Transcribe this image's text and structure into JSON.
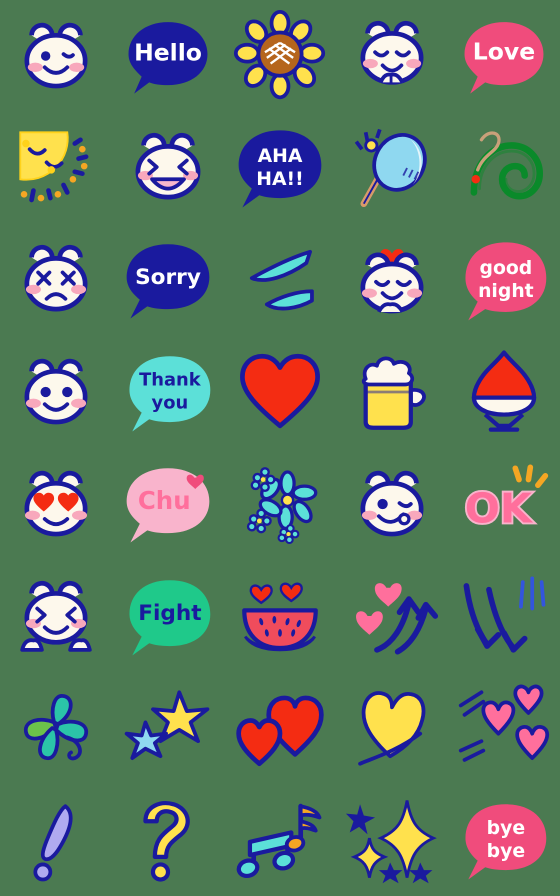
{
  "sheet": {
    "title": "Emoji Sticker Sheet",
    "columns": 5,
    "rows": 8,
    "background_color": "#4b7a51",
    "palette": {
      "navy": "#1a1a9e",
      "navy_dark": "#181878",
      "cream": "#fdf8ec",
      "white": "#ffffff",
      "pink_cheek": "#f8a8bc",
      "pink_bubble": "#f04c7c",
      "pink_soft": "#f9b4cc",
      "pink_hot": "#ff6f9c",
      "cyan": "#5ce0d8",
      "cyan_light": "#7fe6f0",
      "green": "#1fc98a",
      "green_dark": "#0a8a2a",
      "yellow": "#ffe14d",
      "yellow_deep": "#ffd21a",
      "orange": "#f5a623",
      "red": "#f42c12",
      "red_heart": "#ee2b12",
      "brown": "#b5651d",
      "purple": "#b0aaf0",
      "sky": "#8fd8f0",
      "lime": "#6cc24a",
      "teal": "#2bc4a8"
    }
  },
  "items": [
    {
      "index": 1,
      "row": 1,
      "col": 1,
      "name": "bear-wink",
      "kind": "character",
      "label": "winking bear face"
    },
    {
      "index": 2,
      "row": 1,
      "col": 2,
      "name": "bubble-hello",
      "kind": "speech-bubble",
      "text": "Hello",
      "bubble_color": "#1a1a9e",
      "text_color": "#ffffff"
    },
    {
      "index": 3,
      "row": 1,
      "col": 3,
      "name": "sunflower",
      "kind": "object",
      "label": "sunflower"
    },
    {
      "index": 4,
      "row": 1,
      "col": 4,
      "name": "bear-shy-paws",
      "kind": "character",
      "label": "shy bear with paws"
    },
    {
      "index": 5,
      "row": 1,
      "col": 5,
      "name": "bubble-love",
      "kind": "speech-bubble",
      "text": "Love",
      "bubble_color": "#f04c7c",
      "text_color": "#ffffff"
    },
    {
      "index": 6,
      "row": 2,
      "col": 1,
      "name": "sun-sleeping",
      "kind": "object",
      "label": "sleeping sun"
    },
    {
      "index": 7,
      "row": 2,
      "col": 2,
      "name": "bear-laughing",
      "kind": "character",
      "label": "laughing bear"
    },
    {
      "index": 8,
      "row": 2,
      "col": 3,
      "name": "bubble-ahaha",
      "kind": "speech-bubble",
      "text_lines": [
        "AHA",
        "HA!!"
      ],
      "bubble_color": "#1a1a9e",
      "text_color": "#ffffff"
    },
    {
      "index": 9,
      "row": 2,
      "col": 4,
      "name": "hand-fan",
      "kind": "object",
      "label": "round hand fan"
    },
    {
      "index": 10,
      "row": 2,
      "col": 5,
      "name": "mosquito-coil",
      "kind": "object",
      "label": "mosquito coil"
    },
    {
      "index": 11,
      "row": 3,
      "col": 1,
      "name": "bear-crying",
      "kind": "character",
      "label": "sad squinting bear"
    },
    {
      "index": 12,
      "row": 3,
      "col": 2,
      "name": "bubble-sorry",
      "kind": "speech-bubble",
      "text": "Sorry",
      "bubble_color": "#1a1a9e",
      "text_color": "#ffffff"
    },
    {
      "index": 13,
      "row": 3,
      "col": 3,
      "name": "sweat-drops",
      "kind": "object",
      "label": "two sweat drops"
    },
    {
      "index": 14,
      "row": 3,
      "col": 4,
      "name": "bear-heart-head",
      "kind": "character",
      "label": "happy bear with heart"
    },
    {
      "index": 15,
      "row": 3,
      "col": 5,
      "name": "bubble-good-night",
      "kind": "speech-bubble",
      "text_lines": [
        "good",
        "night"
      ],
      "bubble_color": "#f04c7c",
      "text_color": "#ffffff"
    },
    {
      "index": 16,
      "row": 4,
      "col": 1,
      "name": "bear-smile",
      "kind": "character",
      "label": "smiling bear"
    },
    {
      "index": 17,
      "row": 4,
      "col": 2,
      "name": "bubble-thank-you",
      "kind": "speech-bubble",
      "text_lines": [
        "Thank",
        "you"
      ],
      "bubble_color": "#5ce0d8",
      "text_color": "#1a1a9e"
    },
    {
      "index": 18,
      "row": 4,
      "col": 3,
      "name": "heart-red",
      "kind": "object",
      "label": "red heart"
    },
    {
      "index": 19,
      "row": 4,
      "col": 4,
      "name": "beer-mug",
      "kind": "object",
      "label": "beer mug"
    },
    {
      "index": 20,
      "row": 4,
      "col": 5,
      "name": "shaved-ice",
      "kind": "object",
      "label": "strawberry shaved ice"
    },
    {
      "index": 21,
      "row": 5,
      "col": 1,
      "name": "bear-heart-eyes",
      "kind": "character",
      "label": "heart eyes bear"
    },
    {
      "index": 22,
      "row": 5,
      "col": 2,
      "name": "bubble-chu",
      "kind": "speech-bubble",
      "text": "Chu",
      "bubble_color": "#f9b4cc",
      "text_color": "#ff6f9c"
    },
    {
      "index": 23,
      "row": 5,
      "col": 3,
      "name": "blue-flowers",
      "kind": "object",
      "label": "blue flowers"
    },
    {
      "index": 24,
      "row": 5,
      "col": 4,
      "name": "bear-wink-tongue",
      "kind": "character",
      "label": "winking bear with tongue"
    },
    {
      "index": 25,
      "row": 5,
      "col": 5,
      "name": "text-ok",
      "kind": "text",
      "text": "OK",
      "text_color": "#ff6f9c"
    },
    {
      "index": 26,
      "row": 6,
      "col": 1,
      "name": "bear-happy-paws",
      "kind": "character",
      "label": "happy bear with paws"
    },
    {
      "index": 27,
      "row": 6,
      "col": 2,
      "name": "bubble-fight",
      "kind": "speech-bubble",
      "text": "Fight",
      "bubble_color": "#1fc98a",
      "text_color": "#1a1a9e"
    },
    {
      "index": 28,
      "row": 6,
      "col": 3,
      "name": "watermelon-hearts",
      "kind": "object",
      "label": "watermelon with hearts"
    },
    {
      "index": 29,
      "row": 6,
      "col": 4,
      "name": "arrows-up-hearts",
      "kind": "object",
      "label": "rising arrows with pink hearts"
    },
    {
      "index": 30,
      "row": 6,
      "col": 5,
      "name": "arrows-down",
      "kind": "object",
      "label": "falling arrows"
    },
    {
      "index": 31,
      "row": 7,
      "col": 1,
      "name": "four-leaf-clover",
      "kind": "object",
      "label": "four leaf clover"
    },
    {
      "index": 32,
      "row": 7,
      "col": 2,
      "name": "stars-shooting",
      "kind": "object",
      "label": "yellow and blue stars"
    },
    {
      "index": 33,
      "row": 7,
      "col": 3,
      "name": "hearts-red-pair",
      "kind": "object",
      "label": "two red hearts"
    },
    {
      "index": 34,
      "row": 7,
      "col": 4,
      "name": "heart-yellow",
      "kind": "object",
      "label": "yellow heart"
    },
    {
      "index": 35,
      "row": 7,
      "col": 5,
      "name": "hearts-pink-trio",
      "kind": "object",
      "label": "three pink hearts"
    },
    {
      "index": 36,
      "row": 8,
      "col": 1,
      "name": "exclamation-mark",
      "kind": "symbol",
      "text": "!",
      "text_color": "#b0aaf0"
    },
    {
      "index": 37,
      "row": 8,
      "col": 2,
      "name": "question-mark",
      "kind": "symbol",
      "text": "?",
      "text_color": "#ffe14d"
    },
    {
      "index": 38,
      "row": 8,
      "col": 3,
      "name": "music-notes",
      "kind": "object",
      "label": "music notes"
    },
    {
      "index": 39,
      "row": 8,
      "col": 4,
      "name": "sparkles",
      "kind": "object",
      "label": "sparkles"
    },
    {
      "index": 40,
      "row": 8,
      "col": 5,
      "name": "bubble-bye-bye",
      "kind": "speech-bubble",
      "text_lines": [
        "bye",
        "bye"
      ],
      "bubble_color": "#f04c7c",
      "text_color": "#ffffff"
    }
  ]
}
